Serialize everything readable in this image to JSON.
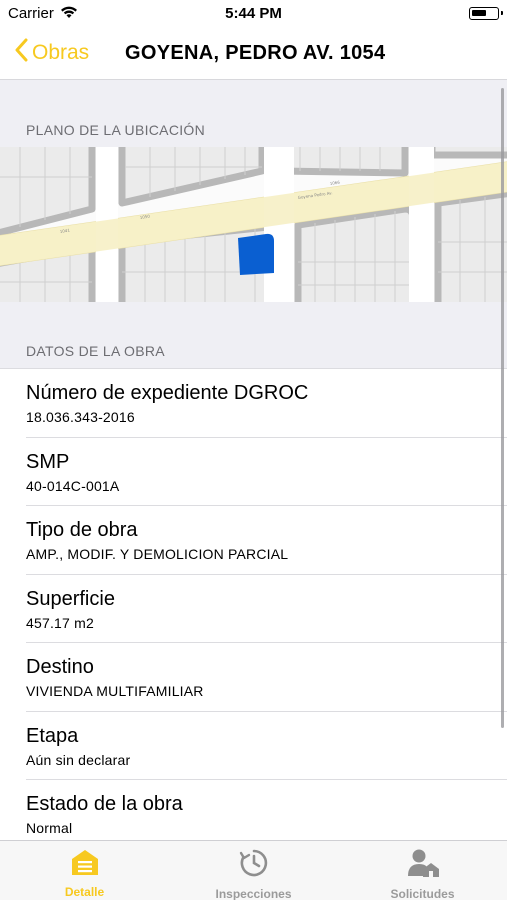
{
  "status": {
    "carrier": "Carrier",
    "time": "5:44 PM"
  },
  "nav": {
    "back_label": "Obras",
    "title": "GOYENA, PEDRO AV. 1054"
  },
  "sections": {
    "map_header": "PLANO DE LA UBICACIÓN",
    "details_header": "DATOS DE LA OBRA"
  },
  "map": {
    "highlight_color": "#0a5fd1",
    "street_color": "#f7f0c8",
    "block_color": "#b8b8b8"
  },
  "details": [
    {
      "label": "Número de expediente DGROC",
      "value": "18.036.343-2016"
    },
    {
      "label": "SMP",
      "value": "40-014C-001A"
    },
    {
      "label": "Tipo de obra",
      "value": "AMP., MODIF. Y DEMOLICION PARCIAL"
    },
    {
      "label": "Superficie",
      "value": "457.17 m2"
    },
    {
      "label": "Destino",
      "value": "VIVIENDA MULTIFAMILIAR"
    },
    {
      "label": "Etapa",
      "value": "Aún sin declarar"
    },
    {
      "label": "Estado de la obra",
      "value": "Normal"
    }
  ],
  "tabs": [
    {
      "label": "Detalle",
      "icon": "detail-icon",
      "active": true
    },
    {
      "label": "Inspecciones",
      "icon": "clock-icon",
      "active": false
    },
    {
      "label": "Solicitudes",
      "icon": "person-home-icon",
      "active": false
    }
  ],
  "colors": {
    "accent": "#f7c920",
    "inactive_tab": "#9b9b9b"
  }
}
